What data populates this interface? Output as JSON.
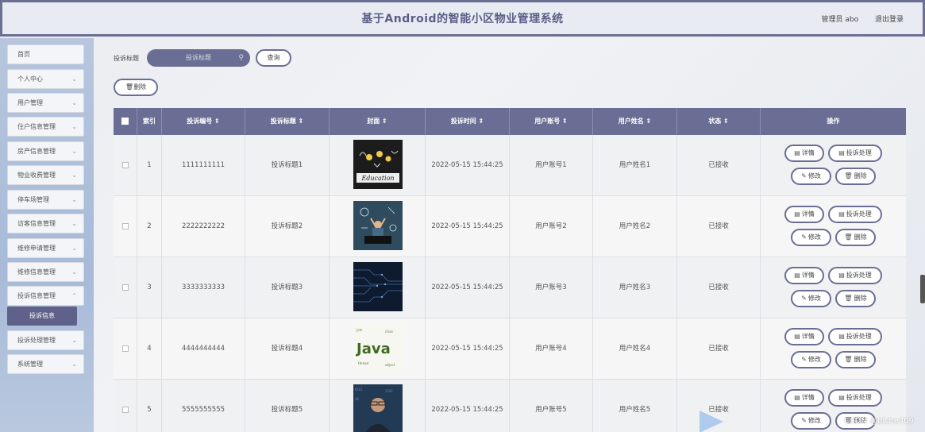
{
  "header": {
    "title": "基于Android的智能小区物业管理系统",
    "user_label": "管理员 abo",
    "logout_label": "退出登录"
  },
  "sidebar": {
    "items": [
      {
        "label": "首页",
        "chevron": false
      },
      {
        "label": "个人中心",
        "chevron": true
      },
      {
        "label": "用户管理",
        "chevron": true
      },
      {
        "label": "住户信息管理",
        "chevron": true
      },
      {
        "label": "房产信息管理",
        "chevron": true
      },
      {
        "label": "物业收费管理",
        "chevron": true
      },
      {
        "label": "停车场管理",
        "chevron": true
      },
      {
        "label": "访客信息管理",
        "chevron": true
      },
      {
        "label": "维修申请管理",
        "chevron": true
      },
      {
        "label": "维修信息管理",
        "chevron": true
      },
      {
        "label": "投诉信息管理",
        "chevron": true
      },
      {
        "label": "投诉处理管理",
        "chevron": true
      },
      {
        "label": "系统管理",
        "chevron": true
      }
    ],
    "active_sub": "投诉信息"
  },
  "search": {
    "label": "投诉标题",
    "placeholder": "投诉标题",
    "query_button": "查询",
    "delete_button": "删除"
  },
  "table": {
    "headers": [
      "索引",
      "投诉编号 ⇕",
      "投诉标题 ⇕",
      "封面 ⇕",
      "投诉时间 ⇕",
      "用户账号 ⇕",
      "用户姓名 ⇕",
      "状态 ⇕",
      "操作"
    ],
    "rows": [
      {
        "index": "1",
        "code": "1111111111",
        "title": "投诉标题1",
        "time": "2022-05-15 15:44:25",
        "account": "用户账号1",
        "name": "用户姓名1",
        "status": "已接收",
        "cover": "education"
      },
      {
        "index": "2",
        "code": "2222222222",
        "title": "投诉标题2",
        "time": "2022-05-15 15:44:25",
        "account": "用户账号2",
        "name": "用户姓名2",
        "status": "已接收",
        "cover": "person-laptop"
      },
      {
        "index": "3",
        "code": "3333333333",
        "title": "投诉标题3",
        "time": "2022-05-15 15:44:25",
        "account": "用户账号3",
        "name": "用户姓名3",
        "status": "已接收",
        "cover": "circuit"
      },
      {
        "index": "4",
        "code": "4444444444",
        "title": "投诉标题4",
        "time": "2022-05-15 15:44:25",
        "account": "用户账号4",
        "name": "用户姓名4",
        "status": "已接收",
        "cover": "java"
      },
      {
        "index": "5",
        "code": "5555555555",
        "title": "投诉标题5",
        "time": "2022-05-15 15:44:25",
        "account": "用户账号5",
        "name": "用户姓名5",
        "status": "已接收",
        "cover": "programmer"
      }
    ],
    "actions": {
      "detail": "详情",
      "handle": "投诉处理",
      "edit": "修改",
      "delete": "删除"
    }
  },
  "cover_text": {
    "education": "Education",
    "java": "Java"
  },
  "watermark": "CSDN @bishe409",
  "colors": {
    "accent": "#6a6e94",
    "sidebar": "#a7bad8"
  }
}
